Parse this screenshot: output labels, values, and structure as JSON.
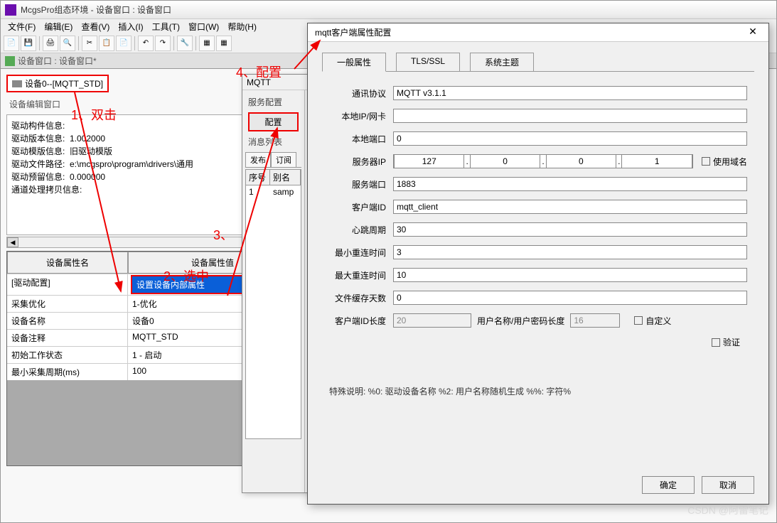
{
  "app": {
    "title": "McgsPro组态环境 - 设备窗口 : 设备窗口"
  },
  "menu": [
    "文件(F)",
    "编辑(E)",
    "查看(V)",
    "插入(I)",
    "工具(T)",
    "窗口(W)",
    "帮助(H)"
  ],
  "subtab": "设备窗口 : 设备窗口*",
  "device_name": "设备0--[MQTT_STD]",
  "edit_label": "设备编辑窗口",
  "info": {
    "l1": "驱动构件信息:",
    "l2": "驱动版本信息:  1.002000",
    "l3": "驱动模版信息:  旧驱动模版",
    "l4": "驱动文件路径:  e:\\mcgspro\\program\\drivers\\通用",
    "l5": "驱动预留信息:  0.000000",
    "l6": "通道处理拷贝信息:"
  },
  "prop_table": {
    "h1": "设备属性名",
    "h2": "设备属性值",
    "rows": [
      {
        "n": "[驱动配置]",
        "v": "设置设备内部属性"
      },
      {
        "n": "采集优化",
        "v": "1-优化"
      },
      {
        "n": "设备名称",
        "v": "设备0"
      },
      {
        "n": "设备注释",
        "v": "MQTT_STD"
      },
      {
        "n": "初始工作状态",
        "v": "1 - 启动"
      },
      {
        "n": "最小采集周期(ms)",
        "v": "100"
      }
    ]
  },
  "mqtt_panel": {
    "title": "MQTT",
    "service": "服务配置",
    "config_btn": "配置",
    "msg_list": "消息列表",
    "tabs": [
      "发布",
      "订阅"
    ],
    "table_h": [
      "序号",
      "别名"
    ],
    "table_r": [
      "1",
      "samp"
    ]
  },
  "dialog": {
    "title": "mqtt客户端属性配置",
    "tabs": [
      "一般属性",
      "TLS/SSL",
      "系统主题"
    ],
    "labels": {
      "protocol": "通讯协议",
      "local_ip": "本地IP/网卡",
      "local_port": "本地端口",
      "server_ip": "服务器IP",
      "use_domain": "使用域名",
      "server_port": "服务端口",
      "client_id": "客户端ID",
      "heartbeat": "心跳周期",
      "min_reconn": "最小重连时间",
      "max_reconn": "最大重连时间",
      "cache_days": "文件缓存天数",
      "client_id_len": "客户端ID长度",
      "user_pwd_len": "用户名称/用户密码长度",
      "custom": "自定义",
      "verify": "验证"
    },
    "values": {
      "protocol": "MQTT v3.1.1",
      "local_port": "0",
      "ip1": "127",
      "ip2": "0",
      "ip3": "0",
      "ip4": "1",
      "server_port": "1883",
      "client_id": "mqtt_client",
      "heartbeat": "30",
      "min_reconn": "3",
      "max_reconn": "10",
      "cache_days": "0",
      "client_id_len": "20",
      "user_pwd_len": "16"
    },
    "special": "特殊说明:     %0:  驱动设备名称          %2:  用户名称随机生成           %%:  字符%",
    "ok": "确定",
    "cancel": "取消"
  },
  "annotations": {
    "a1": "1、双击",
    "a2": "2、选中",
    "a3": "3、",
    "a4": "4、配置"
  },
  "watermark": "CSDN @阿雷笔记"
}
